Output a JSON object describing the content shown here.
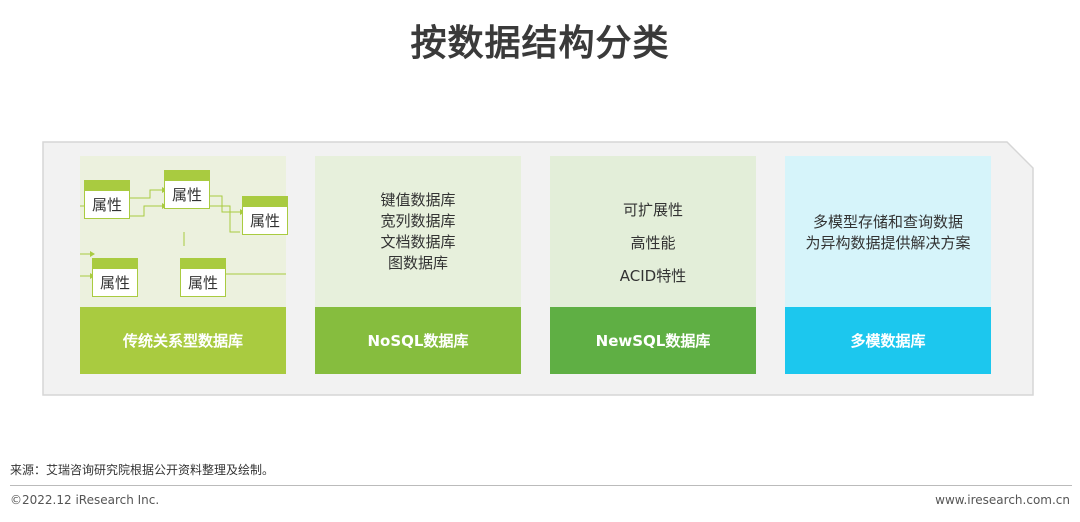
{
  "title": "按数据结构分类",
  "cards": [
    {
      "label": "传统关系型数据库",
      "entities": [
        "属性",
        "属性",
        "属性",
        "属性",
        "属性"
      ]
    },
    {
      "label": "NoSQL数据库",
      "lines": [
        "键值数据库",
        "宽列数据库",
        "文档数据库",
        "图数据库"
      ]
    },
    {
      "label": "NewSQL数据库",
      "lines": [
        "可扩展性",
        "高性能",
        "ACID特性"
      ]
    },
    {
      "label": "多模数据库",
      "lines": [
        "多模型存储和查询数据",
        "为异构数据提供解决方案"
      ]
    }
  ],
  "footer": {
    "source": "来源：艾瑞咨询研究院根据公开资料整理及绘制。",
    "copyright": "©2022.12 iResearch Inc.",
    "website": "www.iresearch.com.cn"
  },
  "colors": {
    "relational": "#a9cb40",
    "nosql": "#86bd3e",
    "newsql": "#5faf44",
    "multimodel": "#1cc7ee"
  }
}
